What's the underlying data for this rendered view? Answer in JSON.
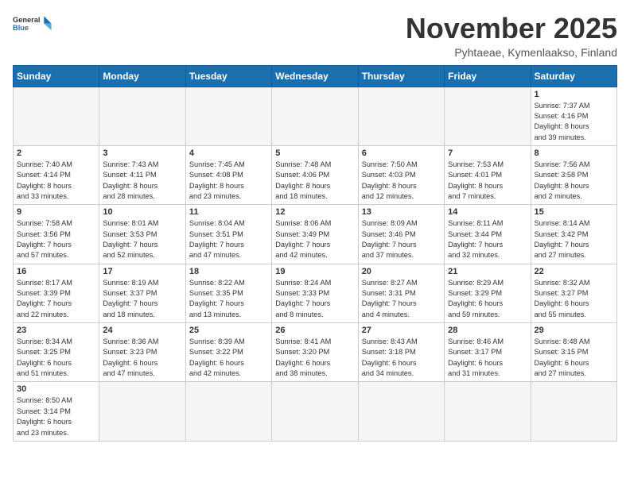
{
  "header": {
    "logo_general": "General",
    "logo_blue": "Blue",
    "month": "November 2025",
    "location": "Pyhtaeae, Kymenlaakso, Finland"
  },
  "weekdays": [
    "Sunday",
    "Monday",
    "Tuesday",
    "Wednesday",
    "Thursday",
    "Friday",
    "Saturday"
  ],
  "weeks": [
    [
      {
        "day": "",
        "info": ""
      },
      {
        "day": "",
        "info": ""
      },
      {
        "day": "",
        "info": ""
      },
      {
        "day": "",
        "info": ""
      },
      {
        "day": "",
        "info": ""
      },
      {
        "day": "",
        "info": ""
      },
      {
        "day": "1",
        "info": "Sunrise: 7:37 AM\nSunset: 4:16 PM\nDaylight: 8 hours\nand 39 minutes."
      }
    ],
    [
      {
        "day": "2",
        "info": "Sunrise: 7:40 AM\nSunset: 4:14 PM\nDaylight: 8 hours\nand 33 minutes."
      },
      {
        "day": "3",
        "info": "Sunrise: 7:43 AM\nSunset: 4:11 PM\nDaylight: 8 hours\nand 28 minutes."
      },
      {
        "day": "4",
        "info": "Sunrise: 7:45 AM\nSunset: 4:08 PM\nDaylight: 8 hours\nand 23 minutes."
      },
      {
        "day": "5",
        "info": "Sunrise: 7:48 AM\nSunset: 4:06 PM\nDaylight: 8 hours\nand 18 minutes."
      },
      {
        "day": "6",
        "info": "Sunrise: 7:50 AM\nSunset: 4:03 PM\nDaylight: 8 hours\nand 12 minutes."
      },
      {
        "day": "7",
        "info": "Sunrise: 7:53 AM\nSunset: 4:01 PM\nDaylight: 8 hours\nand 7 minutes."
      },
      {
        "day": "8",
        "info": "Sunrise: 7:56 AM\nSunset: 3:58 PM\nDaylight: 8 hours\nand 2 minutes."
      }
    ],
    [
      {
        "day": "9",
        "info": "Sunrise: 7:58 AM\nSunset: 3:56 PM\nDaylight: 7 hours\nand 57 minutes."
      },
      {
        "day": "10",
        "info": "Sunrise: 8:01 AM\nSunset: 3:53 PM\nDaylight: 7 hours\nand 52 minutes."
      },
      {
        "day": "11",
        "info": "Sunrise: 8:04 AM\nSunset: 3:51 PM\nDaylight: 7 hours\nand 47 minutes."
      },
      {
        "day": "12",
        "info": "Sunrise: 8:06 AM\nSunset: 3:49 PM\nDaylight: 7 hours\nand 42 minutes."
      },
      {
        "day": "13",
        "info": "Sunrise: 8:09 AM\nSunset: 3:46 PM\nDaylight: 7 hours\nand 37 minutes."
      },
      {
        "day": "14",
        "info": "Sunrise: 8:11 AM\nSunset: 3:44 PM\nDaylight: 7 hours\nand 32 minutes."
      },
      {
        "day": "15",
        "info": "Sunrise: 8:14 AM\nSunset: 3:42 PM\nDaylight: 7 hours\nand 27 minutes."
      }
    ],
    [
      {
        "day": "16",
        "info": "Sunrise: 8:17 AM\nSunset: 3:39 PM\nDaylight: 7 hours\nand 22 minutes."
      },
      {
        "day": "17",
        "info": "Sunrise: 8:19 AM\nSunset: 3:37 PM\nDaylight: 7 hours\nand 18 minutes."
      },
      {
        "day": "18",
        "info": "Sunrise: 8:22 AM\nSunset: 3:35 PM\nDaylight: 7 hours\nand 13 minutes."
      },
      {
        "day": "19",
        "info": "Sunrise: 8:24 AM\nSunset: 3:33 PM\nDaylight: 7 hours\nand 8 minutes."
      },
      {
        "day": "20",
        "info": "Sunrise: 8:27 AM\nSunset: 3:31 PM\nDaylight: 7 hours\nand 4 minutes."
      },
      {
        "day": "21",
        "info": "Sunrise: 8:29 AM\nSunset: 3:29 PM\nDaylight: 6 hours\nand 59 minutes."
      },
      {
        "day": "22",
        "info": "Sunrise: 8:32 AM\nSunset: 3:27 PM\nDaylight: 6 hours\nand 55 minutes."
      }
    ],
    [
      {
        "day": "23",
        "info": "Sunrise: 8:34 AM\nSunset: 3:25 PM\nDaylight: 6 hours\nand 51 minutes."
      },
      {
        "day": "24",
        "info": "Sunrise: 8:36 AM\nSunset: 3:23 PM\nDaylight: 6 hours\nand 47 minutes."
      },
      {
        "day": "25",
        "info": "Sunrise: 8:39 AM\nSunset: 3:22 PM\nDaylight: 6 hours\nand 42 minutes."
      },
      {
        "day": "26",
        "info": "Sunrise: 8:41 AM\nSunset: 3:20 PM\nDaylight: 6 hours\nand 38 minutes."
      },
      {
        "day": "27",
        "info": "Sunrise: 8:43 AM\nSunset: 3:18 PM\nDaylight: 6 hours\nand 34 minutes."
      },
      {
        "day": "28",
        "info": "Sunrise: 8:46 AM\nSunset: 3:17 PM\nDaylight: 6 hours\nand 31 minutes."
      },
      {
        "day": "29",
        "info": "Sunrise: 8:48 AM\nSunset: 3:15 PM\nDaylight: 6 hours\nand 27 minutes."
      }
    ],
    [
      {
        "day": "30",
        "info": "Sunrise: 8:50 AM\nSunset: 3:14 PM\nDaylight: 6 hours\nand 23 minutes."
      },
      {
        "day": "",
        "info": ""
      },
      {
        "day": "",
        "info": ""
      },
      {
        "day": "",
        "info": ""
      },
      {
        "day": "",
        "info": ""
      },
      {
        "day": "",
        "info": ""
      },
      {
        "day": "",
        "info": ""
      }
    ]
  ]
}
